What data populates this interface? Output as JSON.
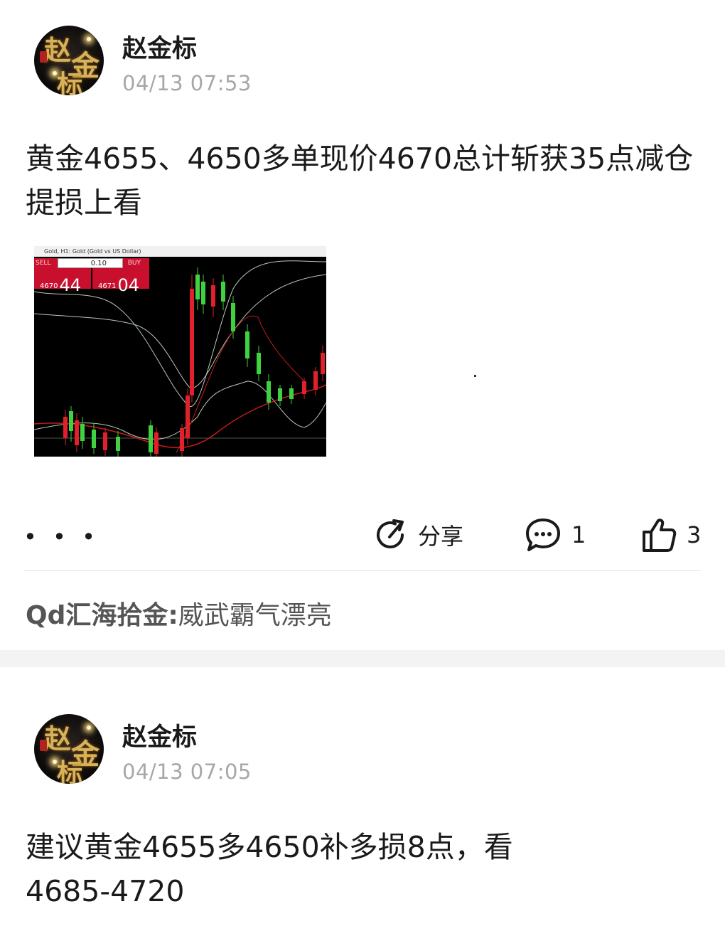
{
  "posts": [
    {
      "author": "赵金标",
      "time": "04/13 07:53",
      "content": "黄金4655、4650多单现价4670总计斩获35点减仓提损上看",
      "screenshot": {
        "window_title": "Gold, H1:  Gold (Gold vs US Dollar)",
        "sell_label": "SELL",
        "buy_label": "BUY",
        "lot_value": "0.10",
        "sell_price_small": "4670",
        "sell_price_big": "44",
        "buy_price_small": "4671",
        "buy_price_big": "04"
      },
      "actions": {
        "more": "• • •",
        "share_label": "分享",
        "comment_count": "1",
        "like_count": "3"
      },
      "comment": {
        "author": "Qd汇海拾金",
        "text": "威武霸气漂亮"
      }
    },
    {
      "author": "赵金标",
      "time": "04/13 07:05",
      "content": "建议黄金4655多4650补多损8点，看4685-4720"
    }
  ],
  "avatar": {
    "chars": [
      "赵",
      "金",
      "标"
    ]
  },
  "colors": {
    "up": "#3fd13f",
    "down": "#e0202a",
    "band": "#b8c8b8",
    "ma": "#c81a1a"
  }
}
